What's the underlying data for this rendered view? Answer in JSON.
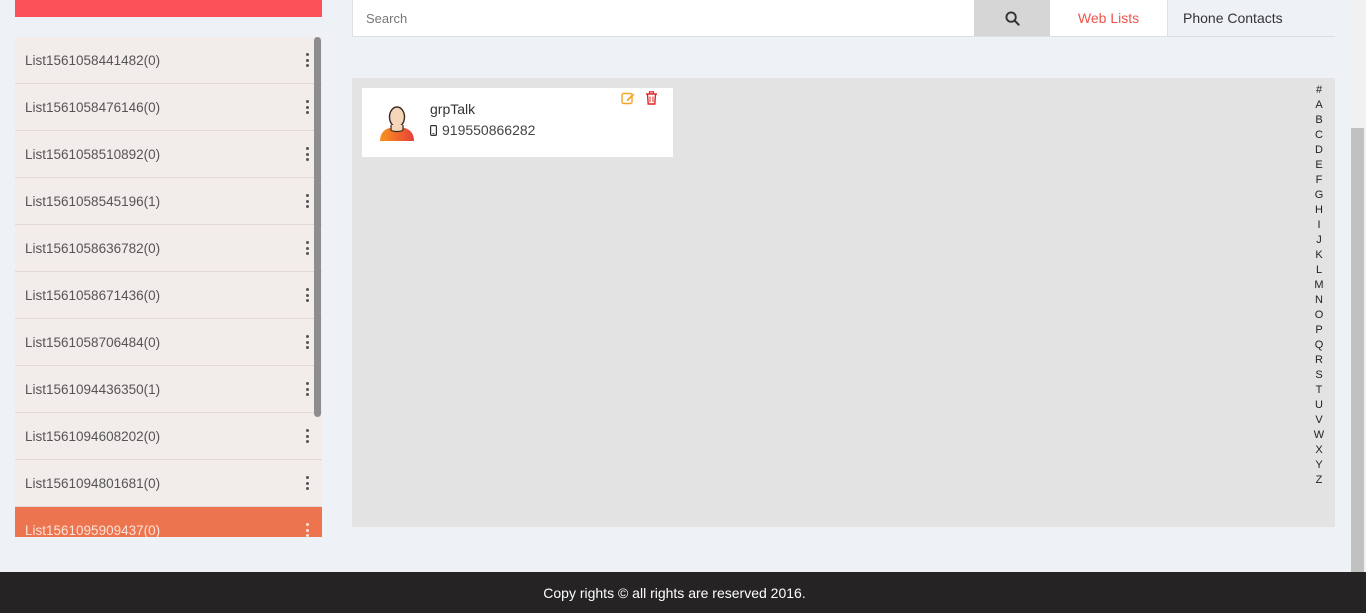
{
  "sidebar": {
    "items": [
      {
        "label": "List1561058441482(0)"
      },
      {
        "label": "List1561058476146(0)"
      },
      {
        "label": "List1561058510892(0)"
      },
      {
        "label": "List1561058545196(1)"
      },
      {
        "label": "List1561058636782(0)"
      },
      {
        "label": "List1561058671436(0)"
      },
      {
        "label": "List1561058706484(0)"
      },
      {
        "label": "List1561094436350(1)"
      },
      {
        "label": "List1561094608202(0)"
      },
      {
        "label": "List1561094801681(0)"
      },
      {
        "label": "List1561095909437(0)"
      }
    ],
    "active_index": 10
  },
  "header": {
    "search": {
      "placeholder": "Search",
      "value": ""
    },
    "search_icon": "search-icon",
    "tabs": [
      {
        "label": "Web Lists",
        "active": true
      },
      {
        "label": "Phone Contacts",
        "active": false
      }
    ]
  },
  "main": {
    "contacts": [
      {
        "name": "grpTalk",
        "phone": "919550866282",
        "avatar_icon": "person-icon",
        "phone_icon": "mobile-icon"
      }
    ],
    "alphabet": [
      "#",
      "A",
      "B",
      "C",
      "D",
      "E",
      "F",
      "G",
      "H",
      "I",
      "J",
      "K",
      "L",
      "M",
      "N",
      "O",
      "P",
      "Q",
      "R",
      "S",
      "T",
      "U",
      "V",
      "W",
      "X",
      "Y",
      "Z"
    ]
  },
  "footer": {
    "text": "Copy rights © all rights are reserved 2016."
  },
  "colors": {
    "accent_red": "#fc5158",
    "active_item": "#ec7550",
    "tab_active_text": "#f0544d",
    "edit_icon": "#f5a623",
    "delete_icon": "#e02424",
    "footer_bg": "#252323"
  }
}
